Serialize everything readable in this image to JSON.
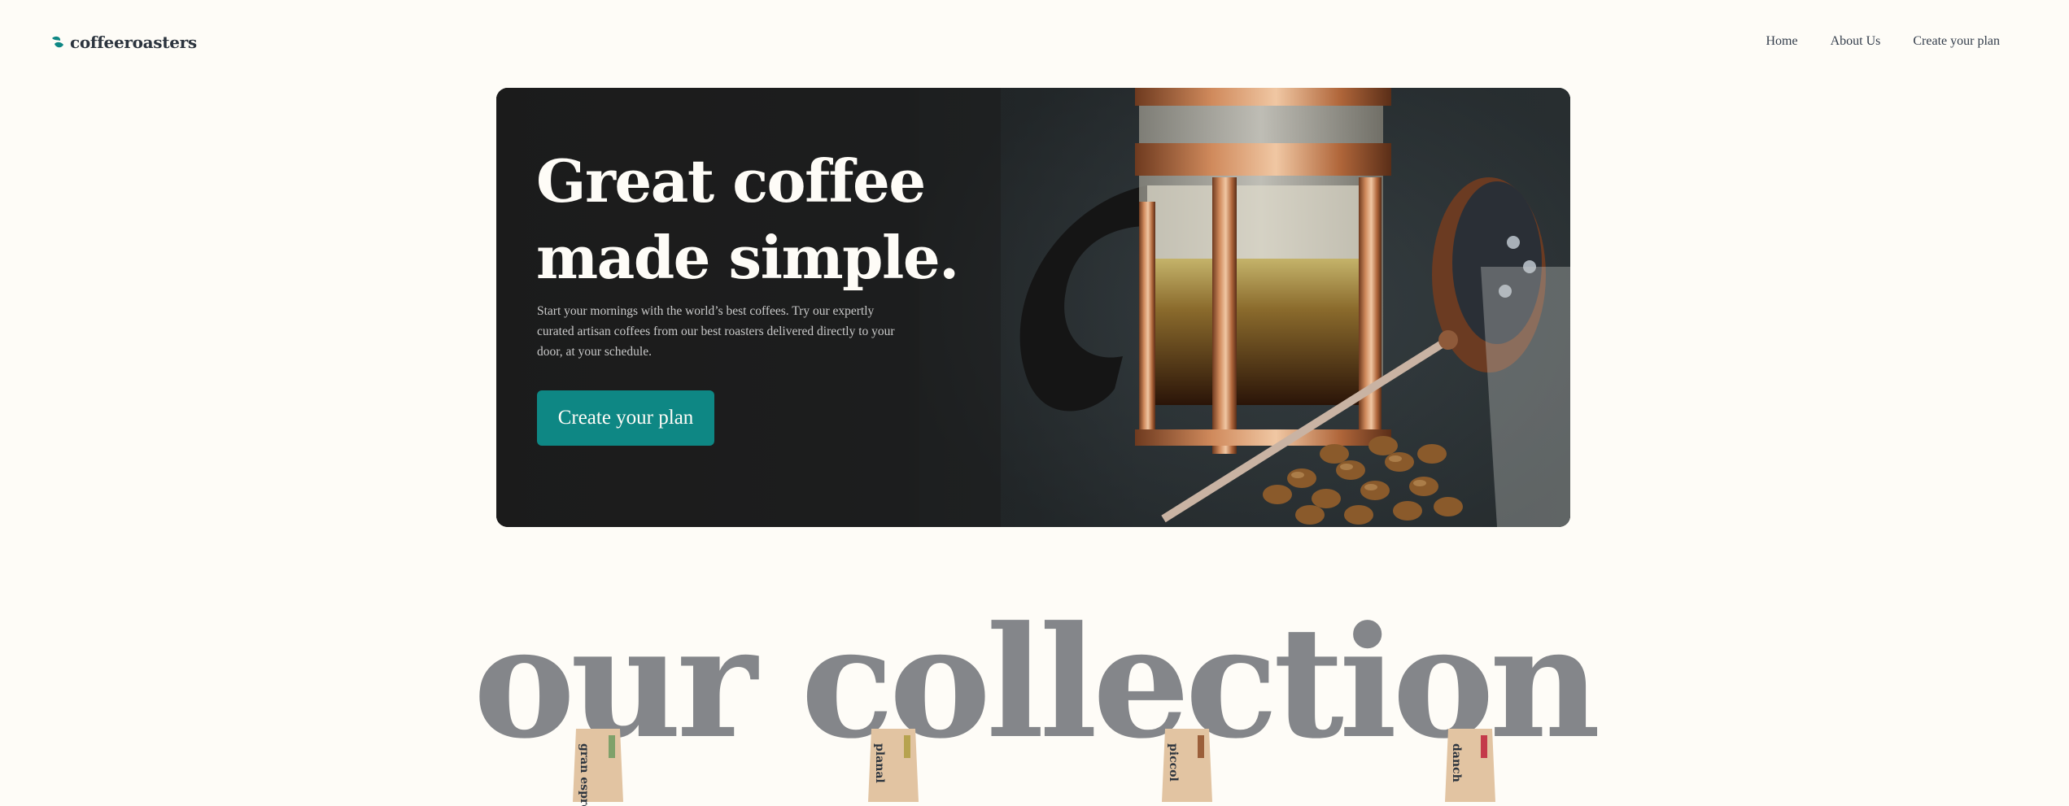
{
  "header": {
    "logo_text": "coffeeroasters",
    "logo_icon": "coffee-bean-icon",
    "nav": [
      {
        "label": "Home"
      },
      {
        "label": "About Us"
      },
      {
        "label": "Create your plan"
      }
    ]
  },
  "hero": {
    "title_line1": "Great coffee",
    "title_line2": "made simple.",
    "description": "Start your mornings with the world’s best coffees. Try our expertly curated artisan coffees from our best roasters delivered directly to your door, at your schedule.",
    "cta_label": "Create your plan",
    "image": "french-press-coffee-photo"
  },
  "collection": {
    "title": "our collection",
    "products": [
      {
        "label_fragment": "gran espre",
        "tab_color": "#7fa16a"
      },
      {
        "label_fragment": "planal",
        "tab_color": "#b7a34f"
      },
      {
        "label_fragment": "piccol",
        "tab_color": "#9b5f3a"
      },
      {
        "label_fragment": "danch",
        "tab_color": "#c43a4a"
      }
    ]
  },
  "colors": {
    "background": "#fefcf7",
    "accent": "#0e8784",
    "dark": "#2c343e",
    "collection_title": "#84868a"
  }
}
